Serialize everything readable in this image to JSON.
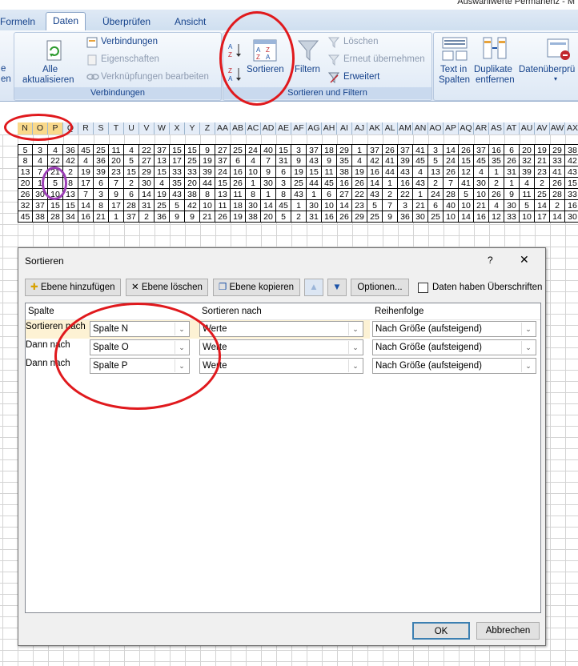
{
  "window": {
    "title": "Auswahlwerte Permanenz - M"
  },
  "tabs": [
    "Formeln",
    "Daten",
    "Überprüfen",
    "Ansicht"
  ],
  "ribbon": {
    "refresh_all": "Alle",
    "refresh_all_2": "aktualisieren",
    "connections": "Verbindungen",
    "properties": "Eigenschaften",
    "edit_links": "Verknüpfungen bearbeiten",
    "group_connections": "Verbindungen",
    "sort": "Sortieren",
    "filter": "Filtern",
    "clear": "Löschen",
    "reapply": "Erneut übernehmen",
    "advanced": "Erweitert",
    "group_sort": "Sortieren und Filtern",
    "text_cols": "Text in",
    "text_cols_2": "Spalten",
    "dupes": "Duplikate",
    "dupes_2": "entfernen",
    "validation": "Datenüberprü",
    "left_frag_1": "e",
    "left_frag_2": "en"
  },
  "columns": [
    "N",
    "O",
    "P",
    "Q",
    "R",
    "S",
    "T",
    "U",
    "V",
    "W",
    "X",
    "Y",
    "Z",
    "AA",
    "AB",
    "AC",
    "AD",
    "AE",
    "AF",
    "AG",
    "AH",
    "AI",
    "AJ",
    "AK",
    "AL",
    "AM",
    "AN",
    "AO",
    "AP",
    "AQ",
    "AR",
    "AS",
    "AT",
    "AU",
    "AV",
    "AW",
    "AX"
  ],
  "selected_columns": [
    "N",
    "O",
    "P"
  ],
  "rows": [
    [
      5,
      3,
      4,
      36,
      45,
      25,
      11,
      4,
      22,
      37,
      15,
      15,
      9,
      27,
      25,
      24,
      40,
      15,
      3,
      37,
      18,
      29,
      1,
      37,
      26,
      37,
      41,
      3,
      14,
      26,
      37,
      16,
      6,
      20,
      19,
      29,
      38
    ],
    [
      8,
      4,
      22,
      42,
      4,
      36,
      20,
      5,
      27,
      13,
      17,
      25,
      19,
      37,
      6,
      4,
      7,
      31,
      9,
      43,
      9,
      35,
      4,
      42,
      41,
      39,
      45,
      5,
      24,
      15,
      45,
      35,
      26,
      32,
      21,
      33,
      42
    ],
    [
      13,
      7,
      21,
      2,
      19,
      39,
      23,
      15,
      29,
      15,
      33,
      33,
      39,
      24,
      16,
      10,
      9,
      6,
      19,
      15,
      11,
      38,
      19,
      16,
      44,
      43,
      4,
      13,
      26,
      12,
      4,
      1,
      31,
      39,
      23,
      41,
      43
    ],
    [
      20,
      1,
      5,
      8,
      17,
      6,
      7,
      2,
      30,
      4,
      35,
      20,
      44,
      15,
      26,
      1,
      30,
      3,
      25,
      44,
      45,
      16,
      26,
      14,
      1,
      16,
      43,
      2,
      7,
      41,
      30,
      2,
      1,
      4,
      2,
      26,
      15
    ],
    [
      26,
      30,
      10,
      13,
      7,
      3,
      9,
      6,
      14,
      19,
      43,
      38,
      8,
      13,
      11,
      8,
      1,
      8,
      43,
      1,
      6,
      27,
      22,
      43,
      2,
      22,
      1,
      24,
      28,
      5,
      10,
      26,
      9,
      11,
      25,
      28,
      33
    ],
    [
      32,
      37,
      15,
      15,
      14,
      8,
      17,
      28,
      31,
      25,
      5,
      42,
      10,
      11,
      18,
      30,
      14,
      45,
      1,
      30,
      10,
      14,
      23,
      5,
      7,
      3,
      21,
      6,
      40,
      10,
      21,
      4,
      30,
      5,
      14,
      2,
      16
    ],
    [
      45,
      38,
      28,
      34,
      16,
      21,
      1,
      37,
      2,
      36,
      9,
      9,
      21,
      26,
      19,
      38,
      20,
      5,
      2,
      31,
      16,
      26,
      29,
      25,
      9,
      36,
      30,
      25,
      10,
      14,
      16,
      12,
      33,
      10,
      17,
      14,
      30
    ]
  ],
  "dialog": {
    "title": "Sortieren",
    "help": "?",
    "close": "✕",
    "add_level": "Ebene hinzufügen",
    "delete_level": "Ebene löschen",
    "copy_level": "Ebene kopieren",
    "options": "Optionen...",
    "headers_checkbox": "Daten haben Überschriften",
    "col_header": "Spalte",
    "sorton_header": "Sortieren nach",
    "order_header": "Reihenfolge",
    "levels": [
      {
        "label": "Sortieren nach",
        "column": "Spalte N",
        "sort_on": "Werte",
        "order": "Nach Größe (aufsteigend)"
      },
      {
        "label": "Dann nach",
        "column": "Spalte O",
        "sort_on": "Werte",
        "order": "Nach Größe (aufsteigend)"
      },
      {
        "label": "Dann nach",
        "column": "Spalte P",
        "sort_on": "Werte",
        "order": "Nach Größe (aufsteigend)"
      }
    ],
    "ok": "OK",
    "cancel": "Abbrechen"
  },
  "colors": {
    "annotation_red": "#e0191d",
    "annotation_purple": "#9b3fb5",
    "selected_col": "#f9d98b"
  }
}
